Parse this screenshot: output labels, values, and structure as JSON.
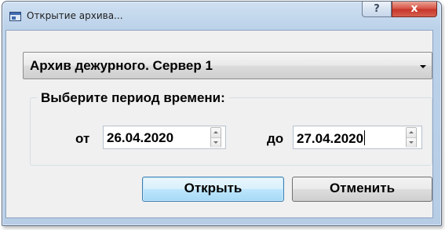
{
  "window": {
    "title": "Открытие архива...",
    "help_label": "?",
    "close_label": "x"
  },
  "archive_select": {
    "selected": "Архив дежурного. Сервер 1"
  },
  "period": {
    "group_title": "Выберите период времени:",
    "from_label": "от",
    "from_value": "26.04.2020",
    "to_label": "до",
    "to_value": "27.04.2020"
  },
  "buttons": {
    "open_label": "Открыть",
    "cancel_label": "Отменить"
  },
  "colors": {
    "title_bar": "#bcd2ea",
    "close_button": "#c7372a",
    "default_button": "#bee6fd",
    "dialog_background": "#f0f0f0"
  }
}
